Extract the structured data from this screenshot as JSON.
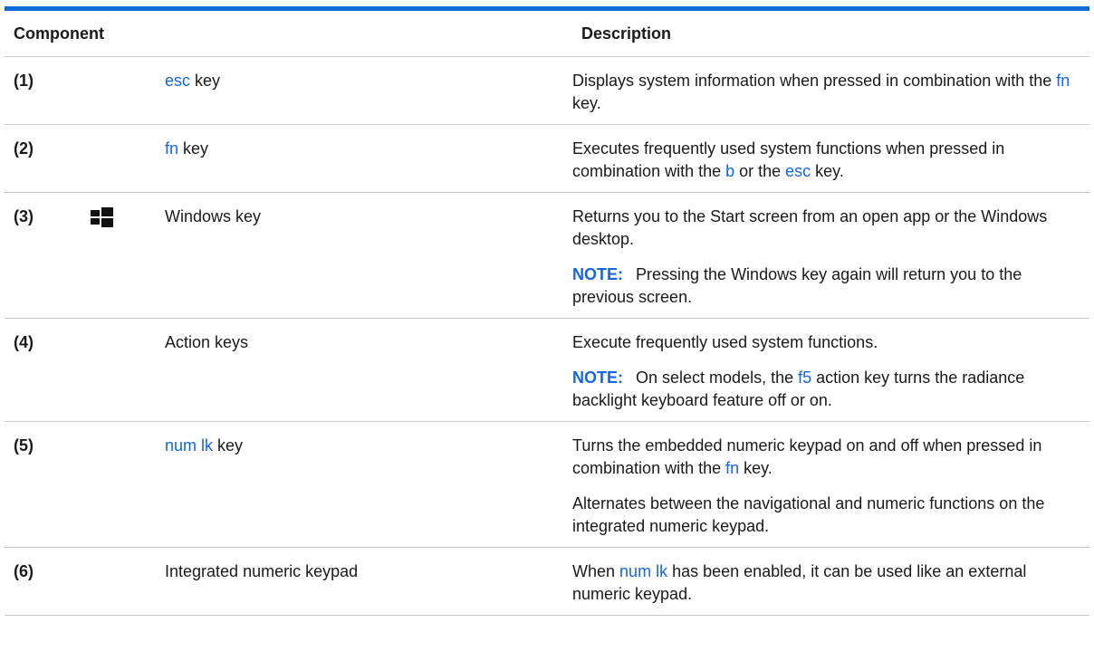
{
  "table": {
    "headers": {
      "component": "Component",
      "description": "Description"
    },
    "rows": [
      {
        "num": "(1)",
        "icon": "",
        "name": {
          "key": "esc",
          "suffix": " key"
        },
        "desc": [
          {
            "parts": [
              {
                "t": "Displays system information when pressed in combination with the "
              },
              {
                "t": "fn",
                "k": true
              },
              {
                "t": " key."
              }
            ]
          }
        ]
      },
      {
        "num": "(2)",
        "icon": "",
        "name": {
          "key": "fn",
          "suffix": " key"
        },
        "desc": [
          {
            "parts": [
              {
                "t": "Executes frequently used system functions when pressed in combination with the "
              },
              {
                "t": "b",
                "k": true
              },
              {
                "t": " or the "
              },
              {
                "t": "esc",
                "k": true
              },
              {
                "t": " key."
              }
            ]
          }
        ]
      },
      {
        "num": "(3)",
        "icon": "windows-logo-icon",
        "name": {
          "key": "",
          "suffix": "Windows key"
        },
        "desc": [
          {
            "parts": [
              {
                "t": "Returns you to the Start screen from an open app or the Windows desktop."
              }
            ]
          },
          {
            "note": "NOTE:",
            "parts": [
              {
                "t": "Pressing the Windows key again will return you to the previous screen."
              }
            ]
          }
        ]
      },
      {
        "num": "(4)",
        "icon": "",
        "name": {
          "key": "",
          "suffix": "Action keys"
        },
        "desc": [
          {
            "parts": [
              {
                "t": "Execute frequently used system functions."
              }
            ]
          },
          {
            "note": "NOTE:",
            "parts": [
              {
                "t": "On select models, the "
              },
              {
                "t": "f5",
                "k": true
              },
              {
                "t": " action key turns the radiance backlight keyboard feature off or on."
              }
            ]
          }
        ]
      },
      {
        "num": "(5)",
        "icon": "",
        "name": {
          "key": "num lk",
          "suffix": " key"
        },
        "desc": [
          {
            "parts": [
              {
                "t": "Turns the embedded numeric keypad on and off when pressed in combination with the "
              },
              {
                "t": "fn",
                "k": true
              },
              {
                "t": " key."
              }
            ]
          },
          {
            "parts": [
              {
                "t": "Alternates between the navigational and numeric functions on the integrated numeric keypad."
              }
            ]
          }
        ]
      },
      {
        "num": "(6)",
        "icon": "",
        "name": {
          "key": "",
          "suffix": "Integrated numeric keypad"
        },
        "desc": [
          {
            "parts": [
              {
                "t": "When "
              },
              {
                "t": "num lk",
                "k": true
              },
              {
                "t": " has been enabled, it can be used like an external numeric keypad."
              }
            ]
          }
        ]
      }
    ]
  },
  "colors": {
    "accent": "#0d6cd8",
    "keyword": "#1466e6",
    "rule": "#c8c8c8"
  }
}
